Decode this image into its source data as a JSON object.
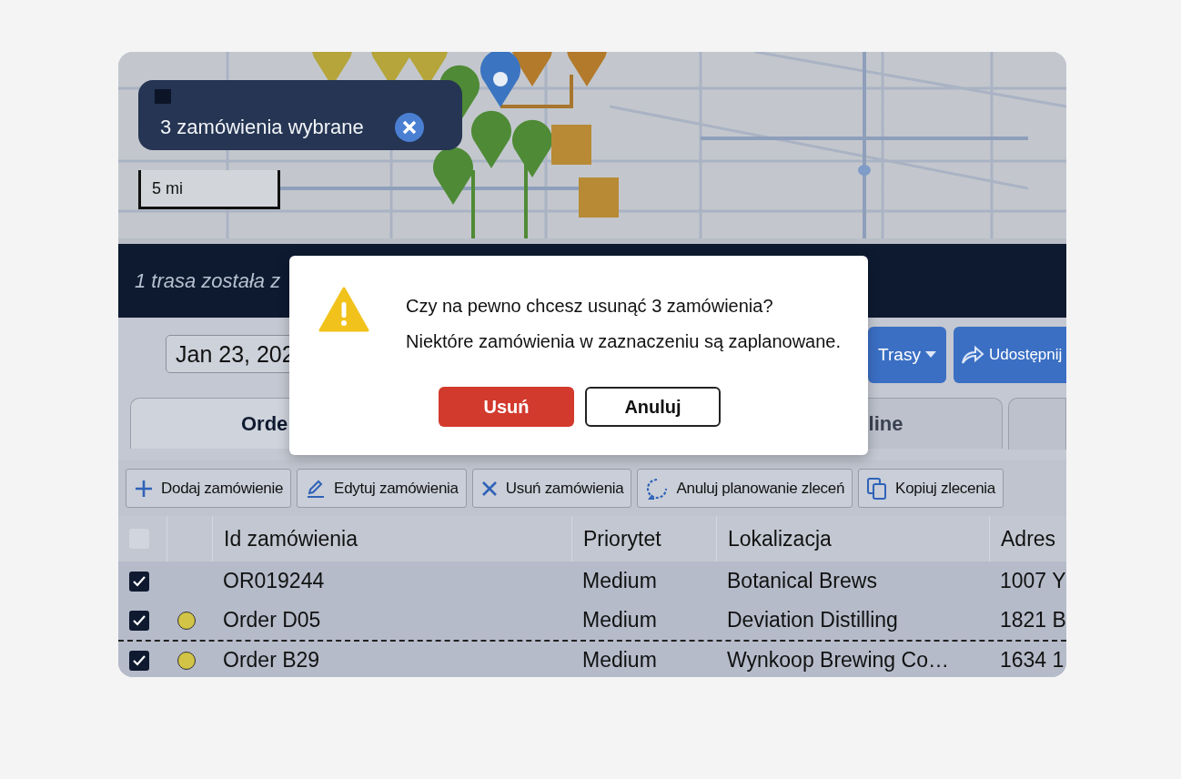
{
  "map": {
    "selection_chip": {
      "label": "3 zamówienia wybrane"
    },
    "scale": "5 mi"
  },
  "banner": {
    "message": "1 trasa została z"
  },
  "date_field": {
    "value": "Jan 23, 202"
  },
  "header_buttons": [
    {
      "label": "Trasy",
      "kind": "dropdown"
    },
    {
      "label": "Udostępnij",
      "kind": "share"
    }
  ],
  "tabs": [
    {
      "label": "Orde",
      "selected": true
    },
    {
      "label": "line",
      "selected": false
    }
  ],
  "actions": [
    {
      "label": "Dodaj zamówienie",
      "kind": "add"
    },
    {
      "label": "Edytuj zamówienia",
      "kind": "edit"
    },
    {
      "label": "Usuń zamówienia",
      "kind": "delete"
    },
    {
      "label": "Anuluj planowanie zleceń",
      "kind": "unschedule"
    },
    {
      "label": "Kopiuj zlecenia",
      "kind": "copy"
    }
  ],
  "table": {
    "select_all": {
      "checked": false
    },
    "columns": [
      "Id zamówienia",
      "Priorytet",
      "Lokalizacja",
      "Adres"
    ],
    "rows": [
      {
        "checked": true,
        "marked": false,
        "cells": [
          "OR019244",
          "Medium",
          "Botanical Brews",
          "1007 Y"
        ]
      },
      {
        "checked": true,
        "marked": false,
        "color": "#d2c447",
        "cells": [
          "Order D05",
          "Medium",
          "Deviation Distilling",
          "1821 B"
        ]
      },
      {
        "checked": true,
        "marked": true,
        "color": "#d2c447",
        "cells": [
          "Order B29",
          "Medium",
          "Wynkoop Brewing Co…",
          "1634 1"
        ]
      }
    ]
  },
  "dialog": {
    "title": "Czy na pewno chcesz usunąć 3 zamówienia?",
    "message": "Niektóre zamówienia w zaznaczeniu są zaplanowane.",
    "buttons": [
      {
        "label": "Usuń",
        "kind": "danger"
      },
      {
        "label": "Anuluj",
        "kind": "secondary"
      }
    ]
  }
}
